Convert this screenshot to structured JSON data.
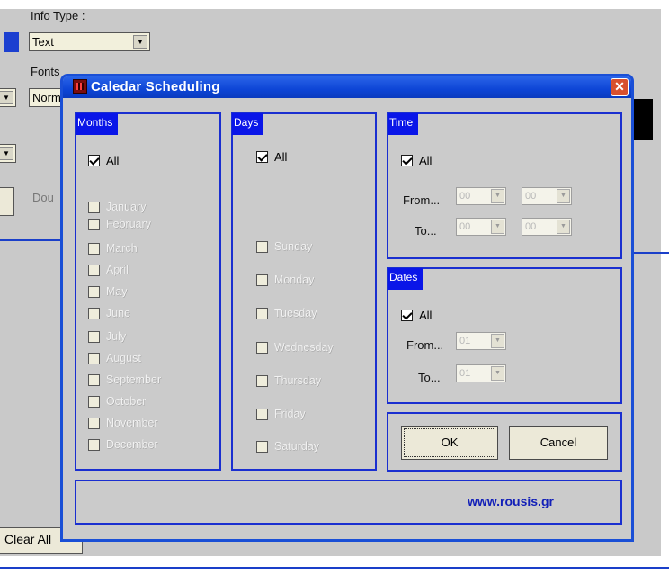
{
  "background": {
    "info_type_label": "Info Type :",
    "info_type_value": "Text",
    "fonts_label": "Fonts",
    "font_value": "Norm",
    "dou_label": "Dou",
    "clear_all_button": "Clear All"
  },
  "dialog": {
    "title": "Caledar Scheduling",
    "close_glyph": "✕",
    "months": {
      "header": "Months",
      "all_label": "All",
      "all_checked": true,
      "items": [
        "January",
        "February",
        "March",
        "April",
        "May",
        "June",
        "July",
        "August",
        "September",
        "October",
        "November",
        "December"
      ]
    },
    "days": {
      "header": "Days",
      "all_label": "All",
      "all_checked": true,
      "items": [
        "Sunday",
        "Monday",
        "Tuesday",
        "Wednesday",
        "Thursday",
        "Friday",
        "Saturday"
      ]
    },
    "time": {
      "header": "Time",
      "all_label": "All",
      "all_checked": true,
      "from_label": "From...",
      "to_label": "To...",
      "from_hour": "00",
      "from_minute": "00",
      "to_hour": "00",
      "to_minute": "00"
    },
    "dates": {
      "header": "Dates",
      "all_label": "All",
      "all_checked": true,
      "from_label": "From...",
      "to_label": "To...",
      "from_value": "01",
      "to_value": "01"
    },
    "ok_label": "OK",
    "cancel_label": "Cancel",
    "website": "www.rousis.gr"
  },
  "colors": {
    "accent_blue": "#1a2fd0",
    "title_blue": "#0d45d6",
    "dialog_bg": "#cbcbcb"
  }
}
